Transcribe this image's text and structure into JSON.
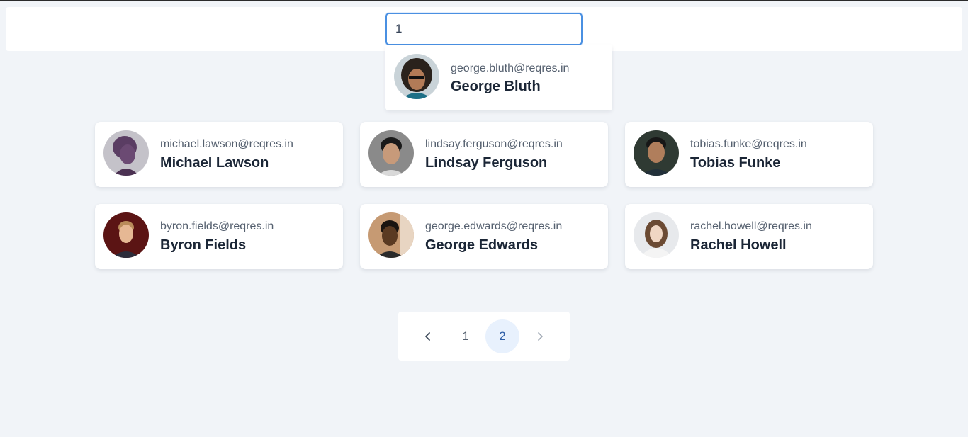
{
  "search": {
    "value": "1"
  },
  "suggestion": {
    "email": "george.bluth@reqres.in",
    "name": "George Bluth",
    "avatar_icon": "avatar-george-bluth"
  },
  "users": [
    {
      "email": "michael.lawson@reqres.in",
      "name": "Michael Lawson",
      "avatar_icon": "avatar-michael-lawson"
    },
    {
      "email": "lindsay.ferguson@reqres.in",
      "name": "Lindsay Ferguson",
      "avatar_icon": "avatar-lindsay-ferguson"
    },
    {
      "email": "tobias.funke@reqres.in",
      "name": "Tobias Funke",
      "avatar_icon": "avatar-tobias-funke"
    },
    {
      "email": "byron.fields@reqres.in",
      "name": "Byron Fields",
      "avatar_icon": "avatar-byron-fields"
    },
    {
      "email": "george.edwards@reqres.in",
      "name": "George Edwards",
      "avatar_icon": "avatar-george-edwards"
    },
    {
      "email": "rachel.howell@reqres.in",
      "name": "Rachel Howell",
      "avatar_icon": "avatar-rachel-howell"
    }
  ],
  "pagination": {
    "prev_icon": "chevron-left-icon",
    "pages": [
      "1",
      "2"
    ],
    "current_page": "2",
    "next_icon": "chevron-right-icon"
  },
  "colors": {
    "background": "#f1f4f8",
    "focus_border": "#4a90e2",
    "active_page_bg": "#e8f1fd",
    "active_page_text": "#2f5fa8"
  }
}
